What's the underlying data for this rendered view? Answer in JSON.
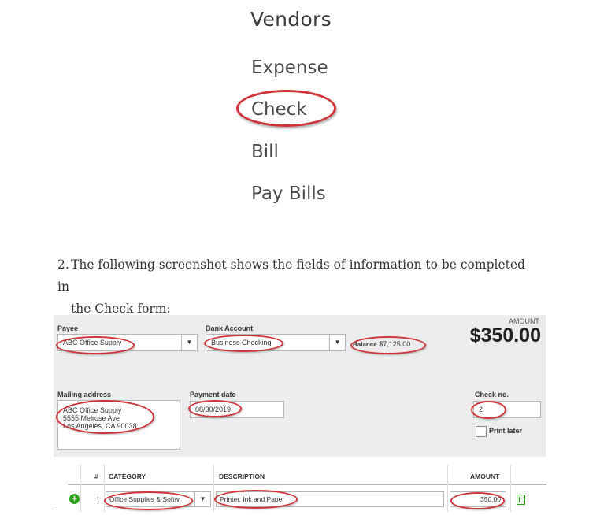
{
  "menu": {
    "title": "Vendors",
    "items": [
      "Expense",
      "Check",
      "Bill",
      "Pay Bills"
    ]
  },
  "step": {
    "number": "2.",
    "line1": "The following screenshot shows the fields of information to be completed in",
    "line2": "the Check form:"
  },
  "check_form": {
    "payee_label": "Payee",
    "payee_value": "ABC Office Supply",
    "bank_label": "Bank Account",
    "bank_value": "Business Checking",
    "balance_label": "Balance",
    "balance_value": "$7,125.00",
    "amount_label": "AMOUNT",
    "amount_value": "$350.00",
    "mailing_label": "Mailing address",
    "mailing_lines": [
      "ABC Office Supply",
      "5555 Melrose Ave",
      "Los Angeles, CA 90038"
    ],
    "date_label": "Payment date",
    "date_value": "08/30/2019",
    "checkno_label": "Check no.",
    "checkno_value": "2",
    "print_later_label": "Print later",
    "dropdown_glyph": "▼"
  },
  "table": {
    "headers": {
      "num": "#",
      "category": "CATEGORY",
      "description": "DESCRIPTION",
      "amount": "AMOUNT"
    },
    "rows": [
      {
        "num": "1",
        "category": "Office Supplies & Softw",
        "description": "Printer, Ink and Paper",
        "amount": "350.00"
      }
    ],
    "add_glyph": "+"
  }
}
